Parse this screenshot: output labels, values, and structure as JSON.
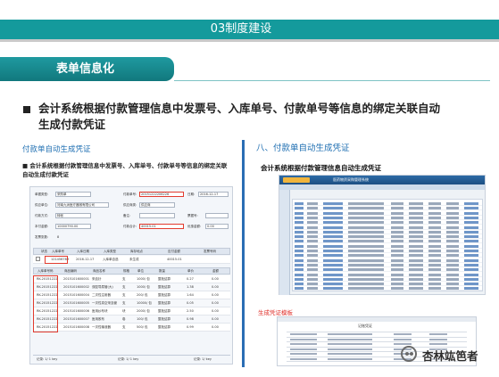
{
  "header": {
    "title": "03制度建设"
  },
  "section": {
    "title": "表单信息化"
  },
  "bullet": {
    "text": "会计系统根据付款管理信息中发票号、入库单号、付款单号等信息的绑定关联自动生成付款凭证"
  },
  "left": {
    "title": "付款单自动生成凭证",
    "desc": "■ 会计系统根据付款管理信息中发票号、入库单号、付款单号等信息的绑定关联自动生成付款凭证",
    "form": {
      "row1": [
        "单据类型:",
        "采购单",
        "付款单号:",
        "20151222206226",
        "日期:",
        "2016-12-17"
      ],
      "row2": [
        "供应单位:",
        "河南九洲医疗器械有限公司",
        "供应商类:",
        "供应商"
      ],
      "row3": [
        "付款方式:",
        "转帐",
        "备注:",
        "",
        "票据号:",
        ""
      ],
      "row4": [
        "本付金额:",
        "10000790.00",
        "付款合计:",
        "40015.01",
        "优惠金额:",
        "0.00"
      ],
      "row5": [
        "发票张数:",
        "8"
      ],
      "head1": [
        "状态",
        "入库单号",
        "入库日期",
        "入库类型",
        "库存地点",
        "应付金额",
        "发票号码"
      ],
      "row_a": [
        "121456789",
        "2016-12-17",
        "入库单自选",
        "未生成",
        "40015.01"
      ],
      "head2": [
        "入库单号码",
        "商品编码",
        "商品名称",
        "规格",
        "单位",
        "数量",
        "单价",
        "金额"
      ],
      "items": [
        [
          "RK-20151222",
          "2015101600001",
          "采血针",
          "支",
          "1000/ 包",
          "整批结算",
          "0.27",
          "0.00"
        ],
        [
          "RK-20151222",
          "2015101600002",
          "双腔导尿管(大)",
          "支",
          "1000/ 包",
          "整批结算",
          "1.38",
          "0.00"
        ],
        [
          "RK-20151222",
          "2015101600004",
          "二次性注射器",
          "支",
          "200/ 包",
          "整批结算",
          "1.64",
          "0.00"
        ],
        [
          "RK-20151222",
          "2015101600005",
          "一次性真空采血管",
          "支",
          "10000/ 包",
          "整批结算",
          "0.05",
          "0.00"
        ],
        [
          "RK-20151222",
          "2015101600006",
          "医用纱布块",
          "块",
          "2000/ 包",
          "整批结算",
          "2.50",
          "0.00"
        ],
        [
          "RK-20151222",
          "2015101600007",
          "医用胶布",
          "卷",
          "100/ 包",
          "整批结算",
          "0.98",
          "0.00"
        ],
        [
          "RK-20151222",
          "2015101600008",
          "一次性输液器",
          "支",
          "500/ 包",
          "整批结算",
          "0.99",
          "0.00"
        ]
      ],
      "footer": [
        "记录: 1/ 1 key",
        "记录: 1/ 1 key",
        "记录: 1/ key"
      ]
    }
  },
  "right": {
    "title": "八、付款单自动生成凭证",
    "subtitle": "会计系统根据付款管理信息自动生成凭证",
    "system_name": "医药物资采购管理系统",
    "voucher_label": "生成凭证模板",
    "voucher_title": "记账凭证"
  },
  "watermark": {
    "text": "杏林竑笆者"
  }
}
